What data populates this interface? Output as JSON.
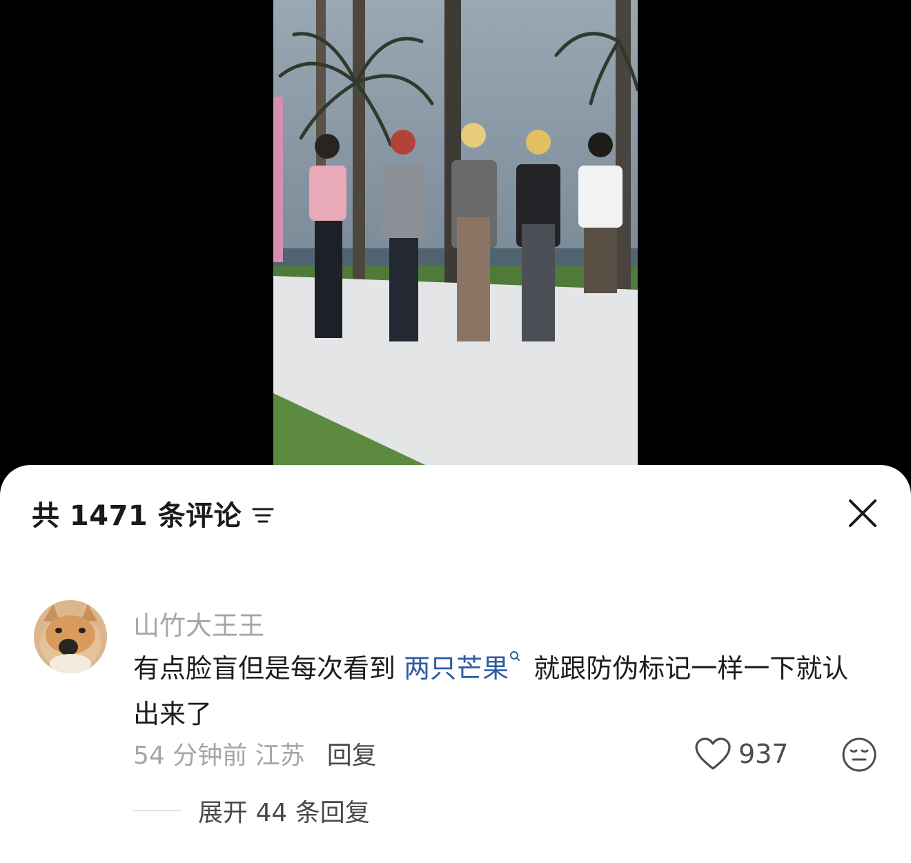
{
  "video": {
    "icon": "video-player"
  },
  "comments_panel": {
    "title": "共 1471 条评论",
    "sort_icon": "sort-filter-icon",
    "close_icon": "close-icon"
  },
  "comment": {
    "author": "山竹大王王",
    "text_before": "有点脸盲但是每次看到 ",
    "mention": "两只芒果",
    "text_after": " 就跟防伪标记一样一下就认出来了",
    "time_location": "54 分钟前 江苏",
    "reply_label": "回复",
    "like_count": "937",
    "expand_replies": "展开 44 条回复",
    "colors": {
      "mention": "#2b5ca3",
      "meta": "#a6a6a6"
    }
  }
}
